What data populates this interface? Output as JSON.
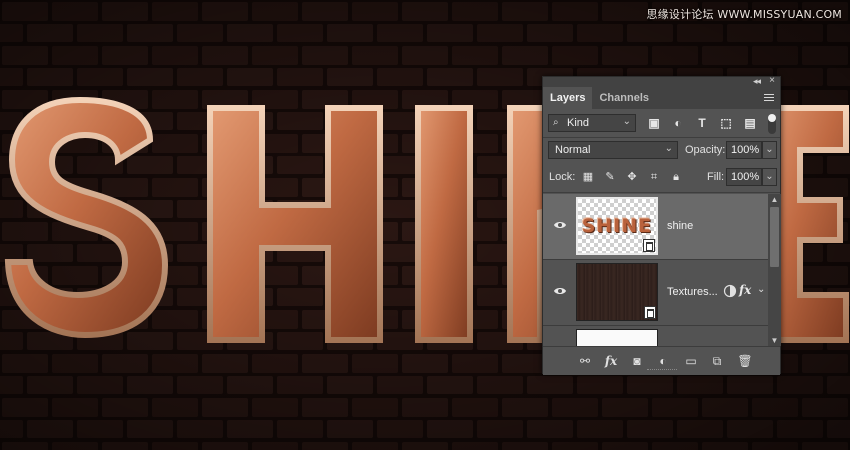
{
  "watermark": "思缘设计论坛 WWW.MISSYUAN.COM",
  "artwork": {
    "text": "SHINE"
  },
  "panel": {
    "tabs": [
      {
        "label": "Layers",
        "active": true
      },
      {
        "label": "Channels",
        "active": false
      }
    ],
    "filter": {
      "kind_label": "Kind"
    },
    "blend_mode": "Normal",
    "opacity_label": "Opacity:",
    "opacity_value": "100%",
    "lock_label": "Lock:",
    "fill_label": "Fill:",
    "fill_value": "100%",
    "layers": [
      {
        "name": "shine",
        "thumb_text": "SHINE",
        "selected": true,
        "visible": true
      },
      {
        "name": "Textures...",
        "selected": false,
        "visible": true,
        "has_fx": true,
        "fx_label": "fx"
      },
      {
        "name": "",
        "selected": false,
        "visible": false
      }
    ],
    "footer_icons": [
      "link-icon",
      "fx-icon",
      "mask-icon",
      "adjustment-icon",
      "group-icon",
      "new-layer-icon",
      "trash-icon"
    ]
  },
  "colors": {
    "panel_bg": "#535353",
    "selected_layer": "#6a6a6a",
    "copper": "#c9774f"
  }
}
